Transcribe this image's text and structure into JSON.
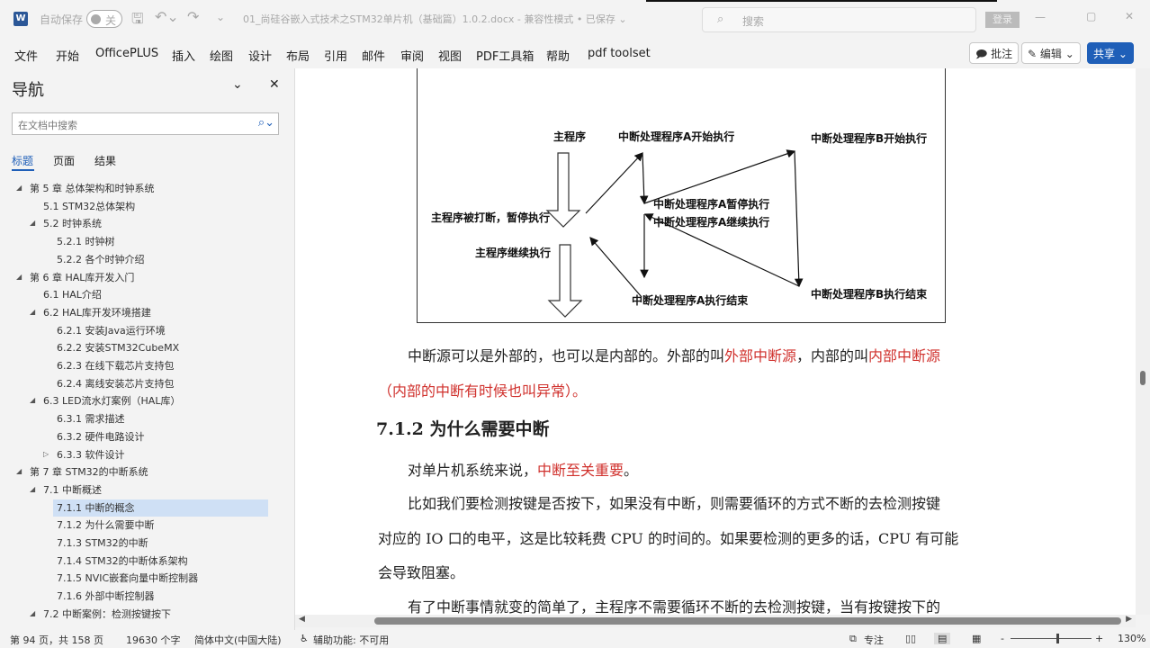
{
  "titlebar": {
    "autosave": "自动保存",
    "toggle": "关",
    "doc_title": "01_尚硅谷嵌入式技术之STM32单片机（基础篇）1.0.2.docx  -  兼容性模式 • 已保存 ⌄",
    "search_placeholder": "搜索",
    "login": "登录"
  },
  "ribbon": {
    "tabs": [
      "文件",
      "开始",
      "OfficePLUS",
      "插入",
      "绘图",
      "设计",
      "布局",
      "引用",
      "邮件",
      "审阅",
      "视图",
      "PDF工具箱",
      "帮助",
      "pdf toolset"
    ],
    "comment": "批注",
    "edit": "编辑",
    "share": "共享"
  },
  "nav": {
    "title": "导航",
    "search_placeholder": "在文档中搜索",
    "tabs": [
      "标题",
      "页面",
      "结果"
    ],
    "items": [
      {
        "label": "第 5 章 总体架构和时钟系统",
        "level": 1,
        "exp": "open"
      },
      {
        "label": "5.1 STM32总体架构",
        "level": 2
      },
      {
        "label": "5.2 时钟系统",
        "level": 2,
        "exp": "open"
      },
      {
        "label": "5.2.1 时钟树",
        "level": 3
      },
      {
        "label": "5.2.2 各个时钟介绍",
        "level": 3
      },
      {
        "label": "第 6 章 HAL库开发入门",
        "level": 1,
        "exp": "open"
      },
      {
        "label": "6.1 HAL介绍",
        "level": 2
      },
      {
        "label": "6.2 HAL库开发环境搭建",
        "level": 2,
        "exp": "open"
      },
      {
        "label": "6.2.1 安装Java运行环境",
        "level": 3
      },
      {
        "label": "6.2.2 安装STM32CubeMX",
        "level": 3
      },
      {
        "label": "6.2.3 在线下载芯片支持包",
        "level": 3
      },
      {
        "label": "6.2.4 离线安装芯片支持包",
        "level": 3
      },
      {
        "label": "6.3 LED流水灯案例（HAL库）",
        "level": 2,
        "exp": "open"
      },
      {
        "label": "6.3.1 需求描述",
        "level": 3
      },
      {
        "label": "6.3.2 硬件电路设计",
        "level": 3
      },
      {
        "label": "6.3.3 软件设计",
        "level": 3,
        "exp": "closed"
      },
      {
        "label": "第 7 章 STM32的中断系统",
        "level": 1,
        "exp": "open"
      },
      {
        "label": "7.1 中断概述",
        "level": 2,
        "exp": "open"
      },
      {
        "label": "7.1.1 中断的概念",
        "level": 3,
        "selected": true
      },
      {
        "label": "7.1.2 为什么需要中断",
        "level": 3
      },
      {
        "label": "7.1.3 STM32的中断",
        "level": 3
      },
      {
        "label": "7.1.4 STM32的中断体系架构",
        "level": 3
      },
      {
        "label": "7.1.5 NVIC嵌套向量中断控制器",
        "level": 3
      },
      {
        "label": "7.1.6 外部中断控制器",
        "level": 3
      },
      {
        "label": "7.2 中断案例：检测按键按下",
        "level": 2,
        "exp": "open"
      }
    ]
  },
  "diagram": {
    "main": "主程序",
    "a_start": "中断处理程序A开始执行",
    "b_start": "中断处理程序B开始执行",
    "a_pause": "中断处理程序A暂停执行",
    "a_resume": "中断处理程序A继续执行",
    "main_interrupted": "主程序被打断，暂停执行",
    "main_resume": "主程序继续执行",
    "a_end": "中断处理程序A执行结束",
    "b_end": "中断处理程序B执行结束"
  },
  "doc": {
    "p1a": "中断源可以是外部的，也可以是内部的。外部的叫",
    "p1b": "外部中断源",
    "p1c": "，内部的叫",
    "p1d": "内部中断源",
    "p1e": "（内部的中断有时候也叫异常）。",
    "heading": "7.1.2 为什么需要中断",
    "p2a": "对单片机系统来说，",
    "p2b": "中断至关重要",
    "p2c": "。",
    "p3l1": "比如我们要检测按键是否按下，如果没有中断，则需要循环的方式不断的去检测按键",
    "p3l2": "对应的 IO 口的电平，这是比较耗费 CPU 的时间的。如果要检测的更多的话，CPU 有可能",
    "p3l3": "会导致阻塞。",
    "p4": "有了中断事情就变的简单了，主程序不需要循环不断的去检测按键，当有按键按下的"
  },
  "status": {
    "page": "第 94 页，共 158 页",
    "words": "19630 个字",
    "lang": "简体中文(中国大陆)",
    "access": "辅助功能: 不可用",
    "focus": "专注",
    "zoom": "130%"
  }
}
